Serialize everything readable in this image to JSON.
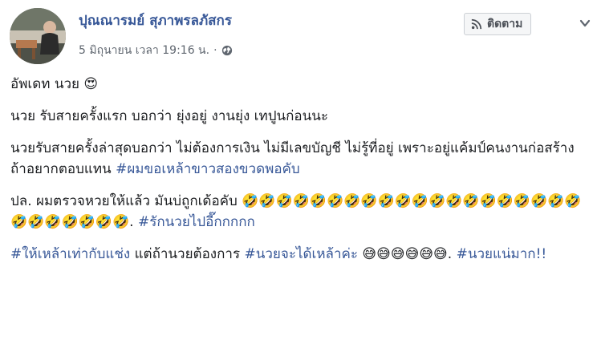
{
  "post": {
    "author": "ปุณณารมย์ สุภาพรลภัสกร",
    "timestamp": "5 มิถุนายน เวลา 19:16 น.",
    "separator": "·",
    "privacy_icon": "globe-icon",
    "follow_label": "ติดตาม",
    "follow_icon": "rss-icon",
    "more_icon": "chevron-down-icon",
    "colors": {
      "link": "#385898",
      "text": "#1c1e21",
      "meta": "#606770"
    }
  },
  "content": {
    "p1_text": "อัพเดท นวย 😍",
    "p2_text": "นวย รับสายครั้งแรก บอกว่า ยุ่งอยู่ งานยุ่ง เทปูนก่อนนะ",
    "p3_text": "นวยรับสายครั้งล่าสุดบอกว่า ไม่ต้องการเงิน ไม่มีเลขบัญชี ไม่รู้ที่อยู่ เพราะอยู่แค้มป์คนงานก่อสร้าง ถ้าอยากตอบแทน ",
    "p3_tag": "#ผมขอเหล้าขาวสองขวดพอคับ",
    "p4_text": "ปล. ผมตรวจหวยให้แล้ว มันบ่ถูกเด้อคับ 🤣🤣🤣🤣🤣🤣🤣🤣🤣🤣🤣🤣🤣🤣🤣🤣🤣🤣🤣🤣🤣🤣🤣🤣🤣🤣🤣. ",
    "p4_tag": "#รักนวยไปอี๊กกกกก",
    "p5_tag1": "#ให้เหล้าเท่ากับแช่ง",
    "p5_mid": " แต่ถ้านวยต้องการ ",
    "p5_tag2": "#นวยจะได้เหล้าค่ะ",
    "p5_emoji": " 😅😅😅😅😅😅. ",
    "p5_tag3": "#นวยแน่มาก!!"
  }
}
